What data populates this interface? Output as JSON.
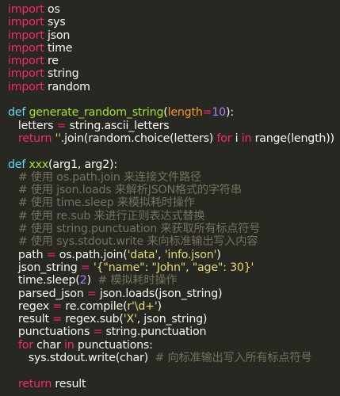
{
  "colors": {
    "background": "#272822",
    "keyword": "#f92672",
    "text": "#f8f8f2",
    "function_name": "#a6e22e",
    "parameter": "#fd971f",
    "number": "#ae81ff",
    "string": "#e6db74",
    "comment": "#75715e",
    "call": "#66d9ef"
  },
  "code": {
    "lines": [
      {
        "tokens": [
          {
            "t": "kw",
            "v": "import"
          },
          {
            "t": "plain",
            "v": " os"
          }
        ]
      },
      {
        "tokens": [
          {
            "t": "kw",
            "v": "import"
          },
          {
            "t": "plain",
            "v": " sys"
          }
        ]
      },
      {
        "tokens": [
          {
            "t": "kw",
            "v": "import"
          },
          {
            "t": "plain",
            "v": " json"
          }
        ]
      },
      {
        "tokens": [
          {
            "t": "kw",
            "v": "import"
          },
          {
            "t": "plain",
            "v": " time"
          }
        ]
      },
      {
        "tokens": [
          {
            "t": "kw",
            "v": "import"
          },
          {
            "t": "plain",
            "v": " re"
          }
        ]
      },
      {
        "tokens": [
          {
            "t": "kw",
            "v": "import"
          },
          {
            "t": "plain",
            "v": " string"
          }
        ]
      },
      {
        "tokens": [
          {
            "t": "kw",
            "v": "import"
          },
          {
            "t": "plain",
            "v": " random"
          }
        ]
      },
      {
        "tokens": []
      },
      {
        "tokens": [
          {
            "t": "call",
            "v": "def"
          },
          {
            "t": "plain",
            "v": " "
          },
          {
            "t": "func",
            "v": "generate_random_string"
          },
          {
            "t": "plain",
            "v": "("
          },
          {
            "t": "param",
            "v": "length"
          },
          {
            "t": "kw",
            "v": "="
          },
          {
            "t": "num",
            "v": "10"
          },
          {
            "t": "plain",
            "v": "):"
          }
        ]
      },
      {
        "tokens": [
          {
            "t": "plain",
            "v": "   letters "
          },
          {
            "t": "kw",
            "v": "="
          },
          {
            "t": "plain",
            "v": " string.ascii_letters"
          }
        ]
      },
      {
        "tokens": [
          {
            "t": "plain",
            "v": "   "
          },
          {
            "t": "kw",
            "v": "return"
          },
          {
            "t": "plain",
            "v": " "
          },
          {
            "t": "str",
            "v": "''"
          },
          {
            "t": "plain",
            "v": ".join(random.choice(letters) "
          },
          {
            "t": "kw",
            "v": "for"
          },
          {
            "t": "plain",
            "v": " i "
          },
          {
            "t": "kw",
            "v": "in"
          },
          {
            "t": "plain",
            "v": " range(length))"
          }
        ]
      },
      {
        "tokens": []
      },
      {
        "tokens": [
          {
            "t": "call",
            "v": "def"
          },
          {
            "t": "plain",
            "v": " "
          },
          {
            "t": "func",
            "v": "xxx"
          },
          {
            "t": "plain",
            "v": "(arg1, arg2):"
          }
        ]
      },
      {
        "tokens": [
          {
            "t": "comment",
            "v": "   # 使用 os.path.join 来连接文件路径"
          }
        ]
      },
      {
        "tokens": [
          {
            "t": "comment",
            "v": "   # 使用 json.loads 来解析JSON格式的字符串"
          }
        ]
      },
      {
        "tokens": [
          {
            "t": "comment",
            "v": "   # 使用 time.sleep 来模拟耗时操作"
          }
        ]
      },
      {
        "tokens": [
          {
            "t": "comment",
            "v": "   # 使用 re.sub 来进行正则表达式替换"
          }
        ]
      },
      {
        "tokens": [
          {
            "t": "comment",
            "v": "   # 使用 string.punctuation 来获取所有标点符号"
          }
        ]
      },
      {
        "tokens": [
          {
            "t": "comment",
            "v": "   # 使用 sys.stdout.write 来向标准输出写入内容"
          }
        ]
      },
      {
        "tokens": [
          {
            "t": "plain",
            "v": "   path "
          },
          {
            "t": "kw",
            "v": "="
          },
          {
            "t": "plain",
            "v": " os.path.join("
          },
          {
            "t": "str",
            "v": "'data'"
          },
          {
            "t": "plain",
            "v": ", "
          },
          {
            "t": "str",
            "v": "'info.json'"
          },
          {
            "t": "plain",
            "v": ")"
          }
        ]
      },
      {
        "tokens": [
          {
            "t": "plain",
            "v": "   json_string "
          },
          {
            "t": "kw",
            "v": "="
          },
          {
            "t": "plain",
            "v": " "
          },
          {
            "t": "str",
            "v": "'{\"name\": \"John\", \"age\": 30}'"
          }
        ]
      },
      {
        "tokens": [
          {
            "t": "plain",
            "v": "   time.sleep("
          },
          {
            "t": "num",
            "v": "2"
          },
          {
            "t": "plain",
            "v": ")  "
          },
          {
            "t": "comment",
            "v": "# 模拟耗时操作"
          }
        ]
      },
      {
        "tokens": [
          {
            "t": "plain",
            "v": "   parsed_json "
          },
          {
            "t": "kw",
            "v": "="
          },
          {
            "t": "plain",
            "v": " json.loads(json_string)"
          }
        ]
      },
      {
        "tokens": [
          {
            "t": "plain",
            "v": "   regex "
          },
          {
            "t": "kw",
            "v": "="
          },
          {
            "t": "plain",
            "v": " re.compile("
          },
          {
            "t": "str",
            "v": "r'\\d+'"
          },
          {
            "t": "plain",
            "v": ")"
          }
        ]
      },
      {
        "tokens": [
          {
            "t": "plain",
            "v": "   result "
          },
          {
            "t": "kw",
            "v": "="
          },
          {
            "t": "plain",
            "v": " regex.sub("
          },
          {
            "t": "str",
            "v": "'X'"
          },
          {
            "t": "plain",
            "v": ", json_string)"
          }
        ]
      },
      {
        "tokens": [
          {
            "t": "plain",
            "v": "   punctuations "
          },
          {
            "t": "kw",
            "v": "="
          },
          {
            "t": "plain",
            "v": " string.punctuation"
          }
        ]
      },
      {
        "tokens": [
          {
            "t": "plain",
            "v": "   "
          },
          {
            "t": "kw",
            "v": "for"
          },
          {
            "t": "plain",
            "v": " char "
          },
          {
            "t": "kw",
            "v": "in"
          },
          {
            "t": "plain",
            "v": " punctuations:"
          }
        ]
      },
      {
        "tokens": [
          {
            "t": "plain",
            "v": "      sys.stdout.write(char)  "
          },
          {
            "t": "comment",
            "v": "# 向标准输出写入所有标点符号"
          }
        ]
      },
      {
        "tokens": []
      },
      {
        "tokens": [
          {
            "t": "plain",
            "v": "   "
          },
          {
            "t": "kw",
            "v": "return"
          },
          {
            "t": "plain",
            "v": " result"
          }
        ]
      }
    ]
  }
}
